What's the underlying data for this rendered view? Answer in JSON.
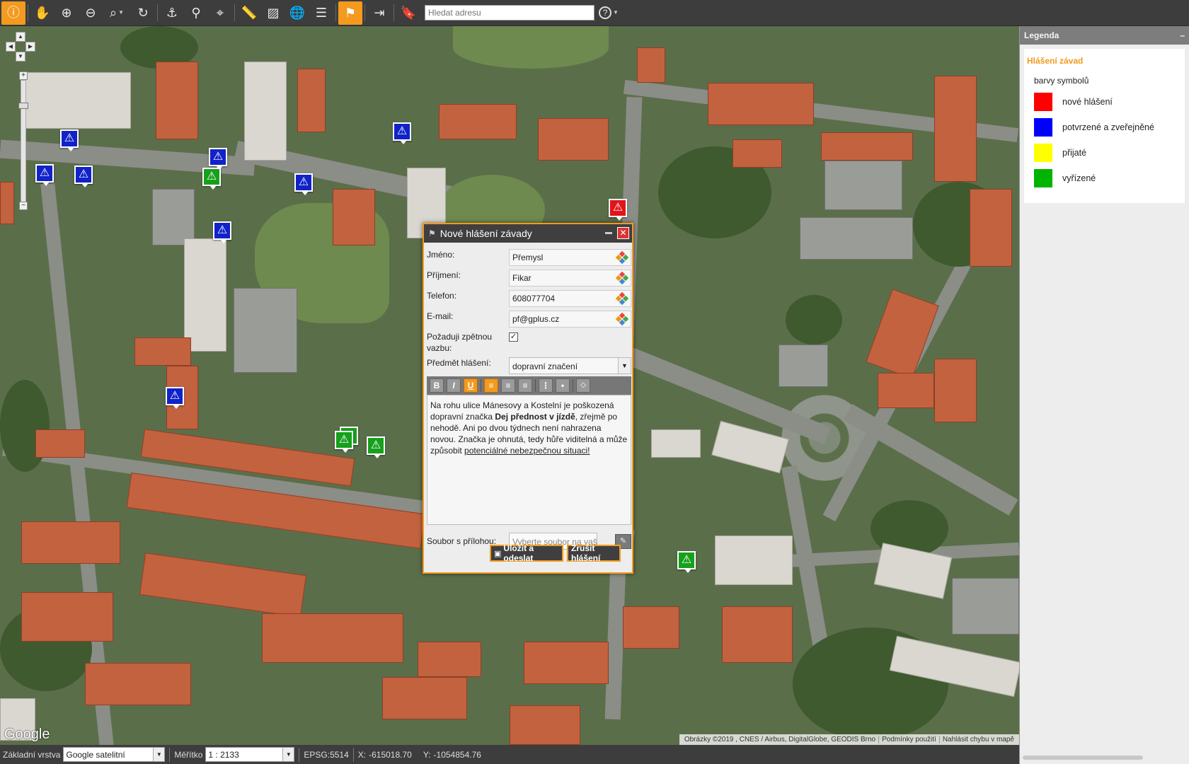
{
  "toolbar": {
    "search_placeholder": "Hledat adresu",
    "help_label": "?"
  },
  "map": {
    "google_logo": "Google",
    "attribution": {
      "imagery": "Obrázky ©2019 , CNES / Airbus, DigitalGlobe, GEODIS Brno",
      "terms": "Podmínky použití",
      "report": "Nahlásit chybu v mapě"
    }
  },
  "legend": {
    "title": "Legenda",
    "collapse": "–",
    "group_title": "Hlášení závad",
    "subtitle": "barvy symbolů",
    "items": [
      {
        "label": "nové hlášení",
        "color": "#ff0000"
      },
      {
        "label": "potvrzené a zveřejněné",
        "color": "#0000ff"
      },
      {
        "label": "přijaté",
        "color": "#ffff00"
      },
      {
        "label": "vyřízené",
        "color": "#00b400"
      }
    ]
  },
  "dialog": {
    "title": "Nové hlášení závady",
    "close": "✕",
    "fields": {
      "first_name_label": "Jméno:",
      "first_name_value": "Přemysl",
      "last_name_label": "Příjmení:",
      "last_name_value": "Fikar",
      "phone_label": "Telefon:",
      "phone_value": "608077704",
      "email_label": "E-mail:",
      "email_value": "pf@gplus.cz",
      "feedback_label": "Požaduji zpětnou vazbu:",
      "feedback_checked": "✓",
      "subject_label": "Předmět hlášení:",
      "subject_value": "dopravní značení"
    },
    "editor": {
      "text_1": "Na rohu ulice Mánesovy a Kostelní je poškozená dopravní značka ",
      "text_bold": "Dej přednost v jízdě",
      "text_2": ", zřejmě po nehodě. Ani po dvou týdnech není nahrazena novou. Značka je ohnutá, tedy hůře viditelná a může způsobit ",
      "text_underline": "potenciálné nebezpečnou situaci!"
    },
    "file_label": "Soubor s přílohou:",
    "file_placeholder": "Vyberte soubor na vaše",
    "save_label": "Uložit a odeslat",
    "cancel_label": "Zrušit hlášení"
  },
  "statusbar": {
    "layer_label": "Základní vrstva",
    "layer_value": "Google satelitní",
    "scale_label": "Měřítko",
    "scale_value": "1 : 2133",
    "epsg": "EPSG:5514",
    "x_label": "X:",
    "x_value": "-615018.70",
    "y_label": "Y:",
    "y_value": "-1054854.76"
  }
}
